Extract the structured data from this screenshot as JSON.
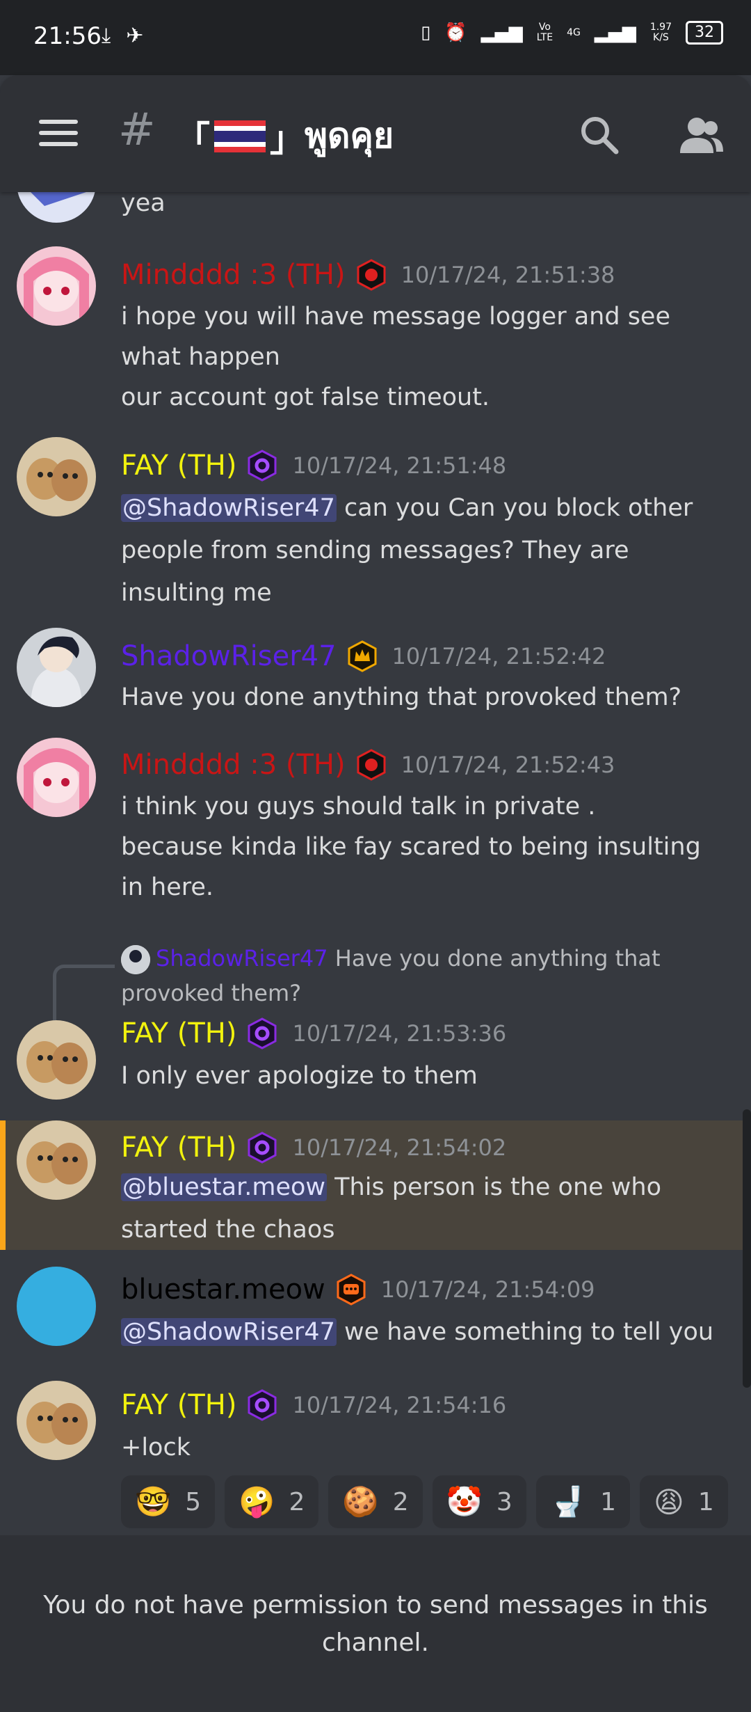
{
  "status_bar": {
    "time": "21:56",
    "net_speed_value": "1.97",
    "net_speed_unit": "K/S",
    "volte_top": "Vo",
    "volte_bottom": "LTE",
    "network": "4G",
    "battery": "32"
  },
  "header": {
    "channel_prefix": "#",
    "channel_bracket_left": "「",
    "channel_bracket_right": "」",
    "channel_text": "พูดคุย"
  },
  "messages": [
    {
      "body": "yea"
    },
    {
      "author": "Mindddd :3 (TH)",
      "author_color": "#c91515",
      "timestamp": "10/17/24, 21:51:38",
      "body": "i hope you will have message logger and see what happen\nour account got false timeout."
    },
    {
      "author": "FAY (TH)",
      "author_color": "#f1f20e",
      "timestamp": "10/17/24, 21:51:48",
      "mention": "@ShadowRiser47",
      "body": " can you Can you block other people from sending messages? They are insulting me"
    },
    {
      "author": "ShadowRiser47",
      "author_color": "#5b21e8",
      "timestamp": "10/17/24, 21:52:42",
      "body": "Have you done anything that provoked them?"
    },
    {
      "author": "Mindddd :3 (TH)",
      "author_color": "#c91515",
      "timestamp": "10/17/24, 21:52:43",
      "body": "i think you guys should talk in private .\nbecause kinda like fay scared to being insulting in here."
    },
    {
      "reply_author": "ShadowRiser47",
      "reply_text": "Have you done anything that provoked them?",
      "author": "FAY (TH)",
      "author_color": "#f1f20e",
      "timestamp": "10/17/24, 21:53:36",
      "body": "I only ever apologize to them"
    },
    {
      "author": "FAY (TH)",
      "author_color": "#f1f20e",
      "timestamp": "10/17/24, 21:54:02",
      "mention": "@bluestar.meow",
      "body": " This person is the one who started the chaos"
    },
    {
      "author": "bluestar.meow",
      "author_color": "#000000",
      "timestamp": "10/17/24, 21:54:09",
      "mention": "@ShadowRiser47",
      "body": " we have something to tell you"
    },
    {
      "author": "FAY (TH)",
      "author_color": "#f1f20e",
      "timestamp": "10/17/24, 21:54:16",
      "body": "+lock"
    }
  ],
  "reactions": [
    {
      "emoji": "🤓",
      "count": "5"
    },
    {
      "emoji": "🤪",
      "count": "2"
    },
    {
      "emoji": "🍪",
      "count": "2"
    },
    {
      "emoji": "🤡",
      "count": "3"
    },
    {
      "emoji": "🚽",
      "count": "1"
    },
    {
      "emoji": "😩",
      "count": "1"
    }
  ],
  "footer": {
    "notice": "You do not have permission to send messages in this channel."
  }
}
